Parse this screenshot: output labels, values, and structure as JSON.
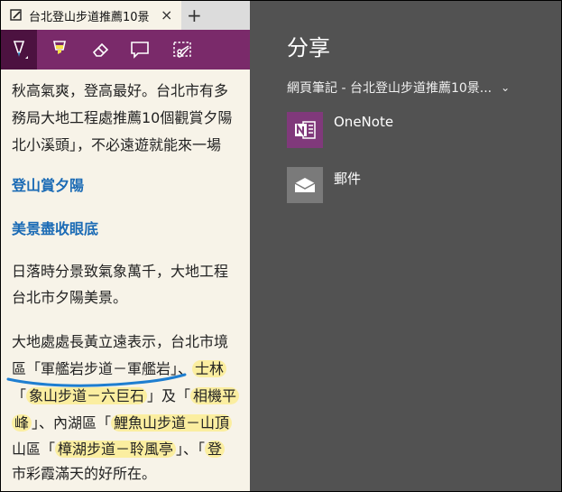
{
  "tab": {
    "title": "台北登山步道推薦10景",
    "close": "×",
    "new_tab": "+"
  },
  "toolbar": {
    "tools": [
      "pen-tool",
      "highlighter-tool",
      "eraser-tool",
      "comment-tool",
      "clip-tool"
    ]
  },
  "article": {
    "lines": [
      "秋高氣爽，登高最好。台北市有多",
      "務局大地工程處推薦10個觀賞夕陽",
      "北小溪頭」，不必遠遊就能來一場",
      "登山賞夕陽",
      "美景盡收眼底",
      "日落時分景致氣象萬千，大地工程",
      "台北市夕陽美景。",
      "大地處處長黃立遠表示，台北市境",
      "區「軍艦岩步道－軍艦岩」、",
      "士林",
      "「",
      "象山步道－六巨石",
      "」及「",
      "相機平",
      "峰",
      "」、內湖區「",
      "鯉魚山步道－山頂",
      "山區「",
      "樟湖步道－聆風亭",
      "」、「",
      "登",
      "市彩霞滿天的好所在。"
    ]
  },
  "share": {
    "title": "分享",
    "target": "網頁筆記 - 台北登山步道推薦10景...",
    "apps": [
      {
        "label": "OneNote",
        "icon": "onenote-icon",
        "color": "#80397b"
      },
      {
        "label": "郵件",
        "icon": "mail-icon",
        "color": "#7a7a7a"
      }
    ]
  }
}
